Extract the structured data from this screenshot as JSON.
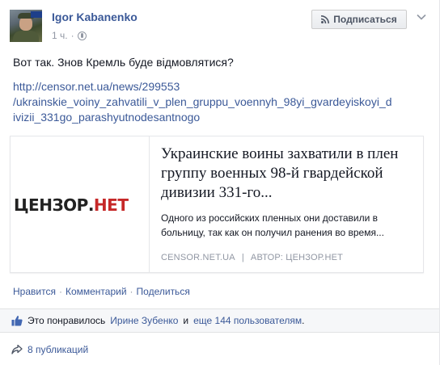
{
  "post": {
    "author": "Igor Kabanenko",
    "time": "1 ч.",
    "time_separator": "·",
    "subscribe_label": "Подписаться",
    "status_text": "Вот так. Знов Кремль буде відмовлятися?",
    "link_lines": [
      "http://censor.net.ua/news/299553",
      "/ukrainskie_voiny_zahvatili_v_plen_gruppu_voennyh_98yi_gvardeyiskoyi_d",
      "ivizii_331go_parashyutnodesantnogo"
    ]
  },
  "preview": {
    "logo_part1": "ЦЕНЗОР.",
    "logo_part2": "НЕТ",
    "title": "Украинские воины захватили в плен группу военных 98-й гвардейской дивизии 331-го...",
    "description": "Одного из российских пленных они доставили в больницу, так как он получил ранения во время...",
    "source": "CENSOR.NET.UA",
    "source_separator": "|",
    "author_label": "АВТОР: ЦЕНЗОР.НЕТ"
  },
  "actions": {
    "like": "Нравится",
    "comment": "Комментарий",
    "share": "Поделиться",
    "separator": "·"
  },
  "likes": {
    "prefix": "Это понравилось",
    "person": "Ирине Зубенко",
    "conjunction": "и",
    "others": "еще 144 пользователям",
    "suffix": "."
  },
  "shares": {
    "label": "8 публикаций"
  },
  "colors": {
    "link": "#3b5998",
    "meta": "#9197a3",
    "text": "#141823",
    "logo_accent": "#c62828"
  }
}
